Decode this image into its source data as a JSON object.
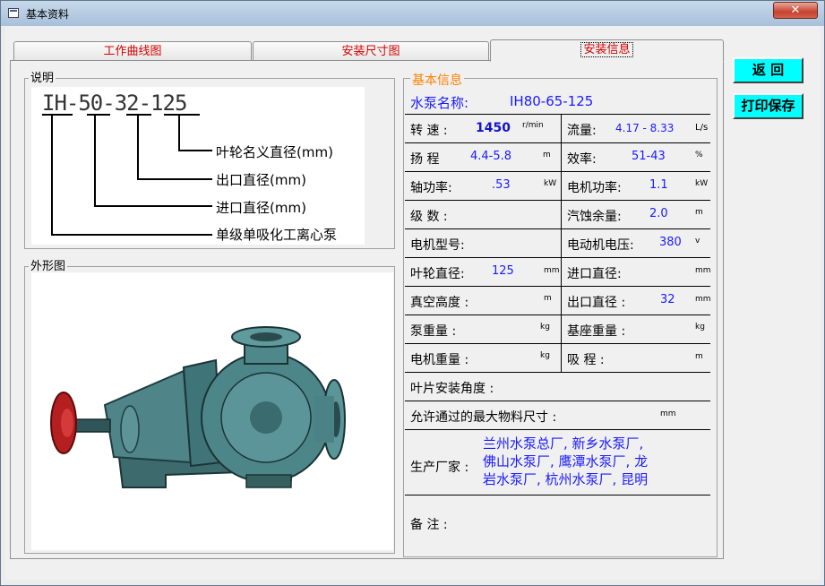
{
  "window": {
    "title": "基本资料",
    "close_glyph": "✕"
  },
  "tabs": [
    {
      "label": "工作曲线图"
    },
    {
      "label": "安装尺寸图"
    },
    {
      "label": "安装信息"
    }
  ],
  "description": {
    "group_label": "说明",
    "model": "IH-50-32-125",
    "legend": [
      "叶轮名义直径(mm)",
      "出口直径(mm)",
      "进口直径(mm)",
      "单级单吸化工离心泵"
    ]
  },
  "appearance": {
    "group_label": "外形图"
  },
  "buttons": {
    "back": "返  回",
    "print_save": "打印保存"
  },
  "info": {
    "section_label": "基本信息",
    "pump_name_label": "水泵名称:",
    "pump_name": "IH80-65-125",
    "speed_label": "转 速 :",
    "speed_value": "1450",
    "speed_unit": "r/min",
    "flow_label": "流量:",
    "flow_value": "4.17 - 8.33",
    "flow_unit": "L/s",
    "head_label": "扬 程",
    "head_value": "4.4-5.8",
    "head_unit": "m",
    "eff_label": "效率:",
    "eff_value": "51-43",
    "eff_unit": "%",
    "shaft_label": "轴功率:",
    "shaft_value": ".53",
    "shaft_unit": "kW",
    "motor_power_label": "电机功率:",
    "motor_power_value": "1.1",
    "motor_power_unit": "kW",
    "stages_label": "级 数 :",
    "npsh_label": "汽蚀余量:",
    "npsh_value": "2.0",
    "npsh_unit": "m",
    "motor_model_label": "电机型号:",
    "motor_voltage_label": "电动机电压:",
    "motor_voltage_value": "380",
    "motor_voltage_unit": "v",
    "impeller_label": "叶轮直径:",
    "impeller_value": "125",
    "impeller_unit": "mm",
    "inlet_label": "进口直径:",
    "inlet_unit": "mm",
    "vacuum_label": "真空高度 :",
    "vacuum_unit": "m",
    "outlet_label": "出口直径 :",
    "outlet_value": "32",
    "outlet_unit": "mm",
    "pump_weight_label": "泵重量 :",
    "pump_weight_unit": "kg",
    "base_weight_label": "基座重量 :",
    "base_weight_unit": "kg",
    "motor_weight_label": "电机重量 :",
    "motor_weight_unit": "kg",
    "suction_label": "吸 程 :",
    "suction_unit": "m",
    "blade_angle_label": "叶片安装角度 :",
    "max_size_label": "允许通过的最大物料尺寸 :",
    "max_size_unit": "mm",
    "maker_label": "生产厂家 :",
    "maker_lines": [
      "兰州水泵总厂, 新乡水泵厂,",
      "佛山水泵厂, 鹰潭水泵厂, 龙",
      "岩水泵厂, 杭州水泵厂, 昆明"
    ],
    "remark_label": "备 注 :"
  }
}
